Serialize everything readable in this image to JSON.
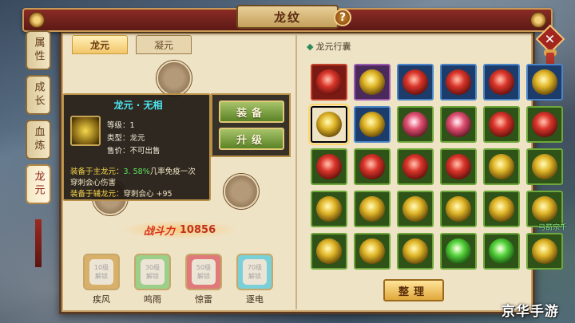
{
  "window": {
    "title": "龙纹",
    "help_symbol": "?"
  },
  "side_tabs": [
    {
      "label": "属性",
      "active": false
    },
    {
      "label": "成长",
      "active": false
    },
    {
      "label": "血炼",
      "active": false
    },
    {
      "label": "龙元",
      "active": true
    }
  ],
  "tabs": [
    {
      "label": "龙元",
      "active": true
    },
    {
      "label": "凝元",
      "active": false
    }
  ],
  "tooltip": {
    "title": "龙元 · 无相",
    "level_line": "等级：1",
    "type_line": "类型：龙元",
    "price_line": "售价：不可出售",
    "main_label": "装备于主龙元：",
    "main_value": "3. 58%",
    "main_text": "几率免疫一次",
    "main_text2": "穿刺会心伤害",
    "sub_label": "装备于辅龙元：",
    "sub_text": "穿刺会心 +95"
  },
  "actions": {
    "equip": "装备",
    "upgrade": "升级"
  },
  "power": {
    "label": "战斗力",
    "value": "10856"
  },
  "locks": [
    {
      "level": "10级",
      "unlock": "解锁",
      "name": "疾风",
      "color": "#d8b06a"
    },
    {
      "level": "30级",
      "unlock": "解锁",
      "name": "鸣雨",
      "color": "#9ccf8a"
    },
    {
      "level": "50级",
      "unlock": "解锁",
      "name": "惊雷",
      "color": "#e07a7a"
    },
    {
      "level": "70级",
      "unlock": "解锁",
      "name": "逐电",
      "color": "#7ad0d8"
    }
  ],
  "bag": {
    "title": "龙元行囊",
    "cells": [
      [
        "red",
        "red"
      ],
      [
        "purple",
        "gold"
      ],
      [
        "blue",
        "red"
      ],
      [
        "blue",
        "red"
      ],
      [
        "blue",
        "red"
      ],
      [
        "blue",
        "gold"
      ],
      [
        "gold",
        "gold"
      ],
      [
        "blue",
        "gold"
      ],
      [
        "green",
        "pink"
      ],
      [
        "green",
        "pink"
      ],
      [
        "green",
        "red"
      ],
      [
        "green",
        "red"
      ],
      [
        "green",
        "red"
      ],
      [
        "green",
        "red"
      ],
      [
        "green",
        "red"
      ],
      [
        "green",
        "red"
      ],
      [
        "green",
        "gold"
      ],
      [
        "green",
        "gold"
      ],
      [
        "green",
        "gold"
      ],
      [
        "green",
        "gold"
      ],
      [
        "green",
        "gold"
      ],
      [
        "green",
        "gold"
      ],
      [
        "green",
        "gold"
      ],
      [
        "green",
        "gold"
      ],
      [
        "green",
        "gold"
      ],
      [
        "green",
        "gold"
      ],
      [
        "green",
        "gold"
      ],
      [
        "green",
        "green"
      ],
      [
        "green",
        "green"
      ],
      [
        "green",
        "gold"
      ]
    ],
    "selected_index": 6
  },
  "sort_button": "整理",
  "watermark": "京华手游",
  "bg_text": "弓箭宗千"
}
